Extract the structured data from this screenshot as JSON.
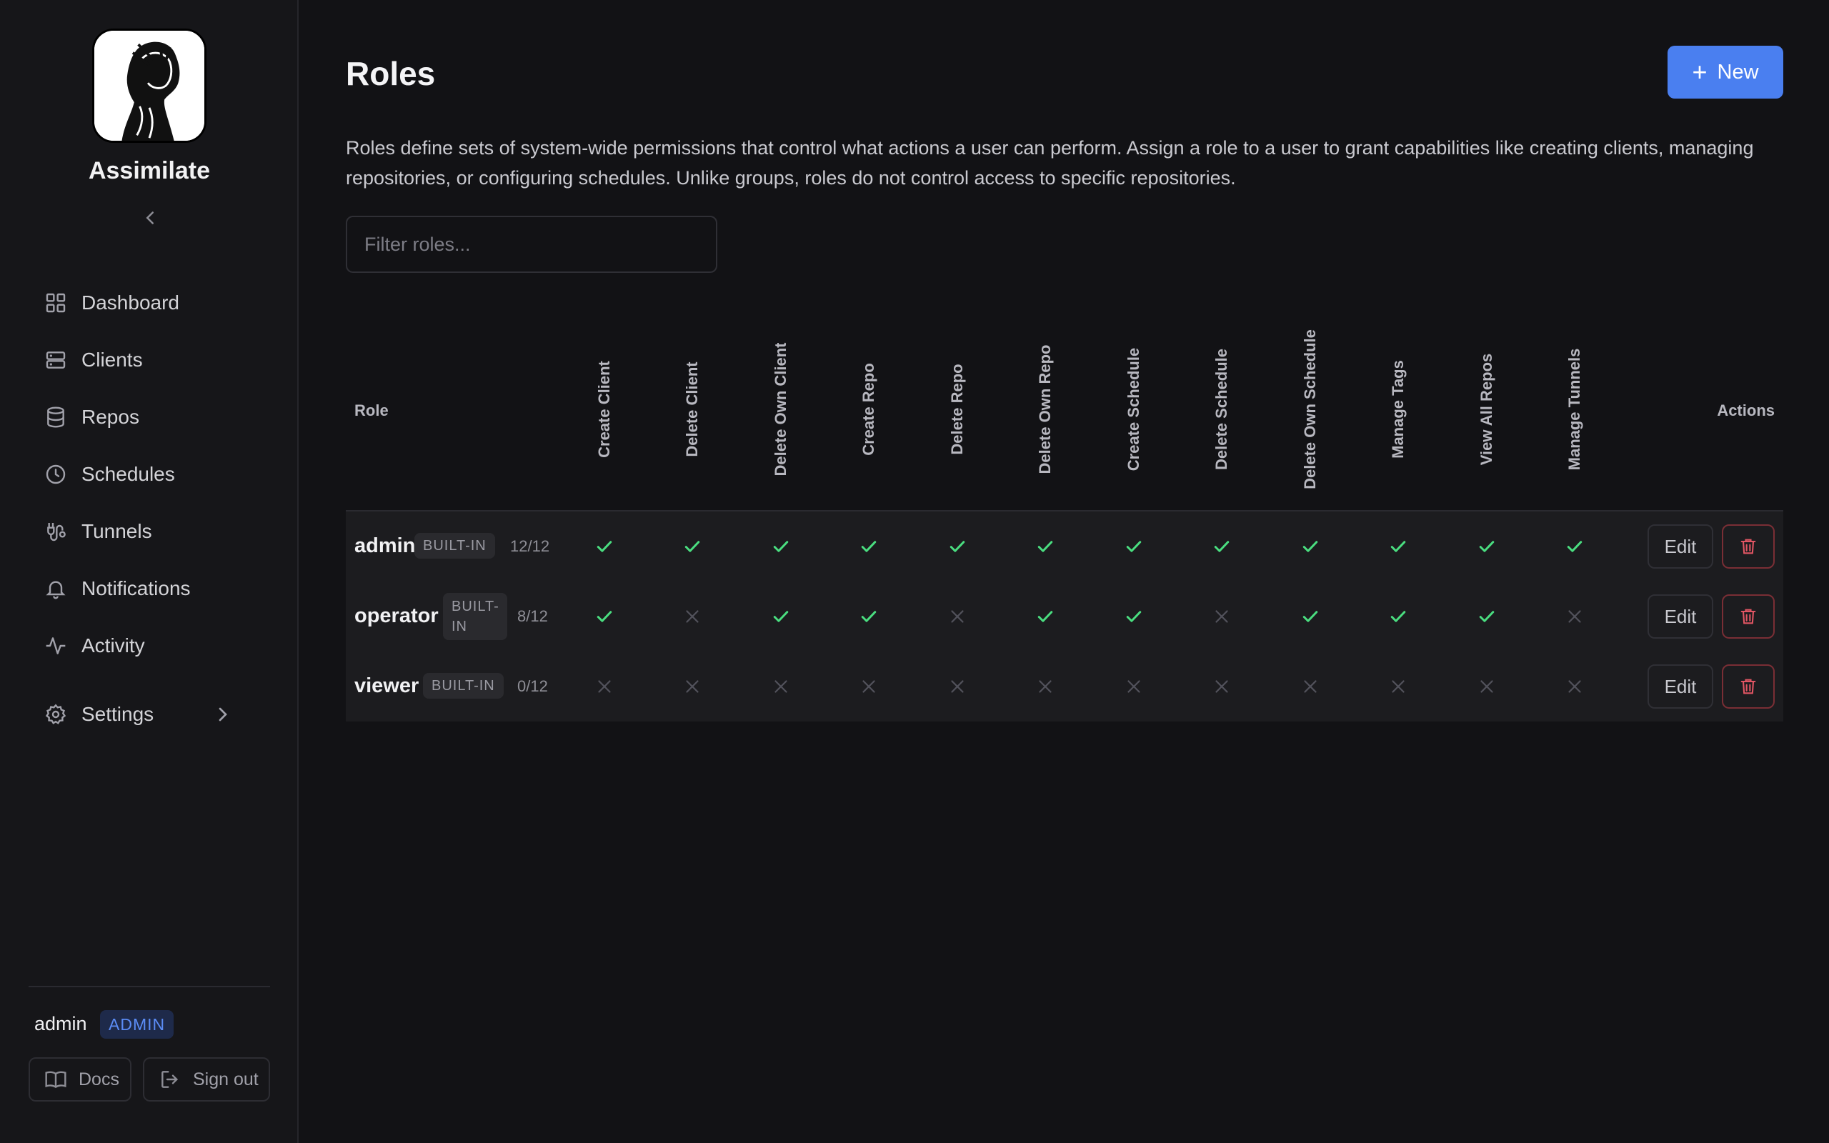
{
  "sidebar": {
    "brand": "Assimilate",
    "nav": [
      {
        "label": "Dashboard",
        "icon": "dashboard-icon"
      },
      {
        "label": "Clients",
        "icon": "server-icon"
      },
      {
        "label": "Repos",
        "icon": "database-icon"
      },
      {
        "label": "Schedules",
        "icon": "clock-icon"
      },
      {
        "label": "Tunnels",
        "icon": "tunnel-icon"
      },
      {
        "label": "Notifications",
        "icon": "bell-icon"
      },
      {
        "label": "Activity",
        "icon": "activity-icon"
      },
      {
        "label": "Settings",
        "icon": "gear-icon"
      }
    ],
    "user": {
      "name": "admin",
      "badge": "ADMIN"
    },
    "docs_label": "Docs",
    "signout_label": "Sign out"
  },
  "main": {
    "title": "Roles",
    "new_label": "New",
    "description": "Roles define sets of system-wide permissions that control what actions a user can perform. Assign a role to a user to grant capabilities like creating clients, managing repositories, or configuring schedules. Unlike groups, roles do not control access to specific repositories.",
    "filter_placeholder": "Filter roles...",
    "table": {
      "role_header": "Role",
      "actions_header": "Actions",
      "permissions": [
        "Create Client",
        "Delete Client",
        "Delete Own Client",
        "Create Repo",
        "Delete Repo",
        "Delete Own Repo",
        "Create Schedule",
        "Delete Schedule",
        "Delete Own Schedule",
        "Manage Tags",
        "View All Repos",
        "Manage Tunnels"
      ],
      "rows": [
        {
          "name": "admin",
          "badge": "BUILT-IN",
          "count": "12/12",
          "grants": [
            true,
            true,
            true,
            true,
            true,
            true,
            true,
            true,
            true,
            true,
            true,
            true
          ]
        },
        {
          "name": "operator",
          "badge": "BUILT-IN",
          "count": "8/12",
          "grants": [
            true,
            false,
            true,
            true,
            false,
            true,
            true,
            false,
            true,
            true,
            true,
            false
          ]
        },
        {
          "name": "viewer",
          "badge": "BUILT-IN",
          "count": "0/12",
          "grants": [
            false,
            false,
            false,
            false,
            false,
            false,
            false,
            false,
            false,
            false,
            false,
            false
          ]
        }
      ],
      "edit_label": "Edit"
    }
  },
  "colors": {
    "accent": "#4a7ff0",
    "check": "#4ade80",
    "cross": "#52525b",
    "danger": "#e05563"
  }
}
